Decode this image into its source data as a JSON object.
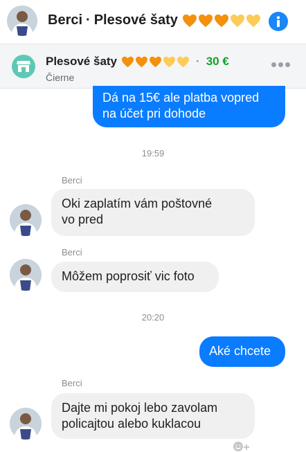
{
  "header": {
    "contact_name": "Berci",
    "separator": "·",
    "item_name": "Plesové šaty",
    "hearts": [
      "orange",
      "orange",
      "orange",
      "yellow",
      "yellow"
    ],
    "info_icon": "info-icon"
  },
  "item_bar": {
    "title": "Plesové šaty",
    "hearts": [
      "orange",
      "orange",
      "orange",
      "yellow",
      "yellow"
    ],
    "separator": "·",
    "price": "30 €",
    "subtitle": "Čierne",
    "shop_icon": "storefront-icon",
    "more_icon": "more-horizontal-icon"
  },
  "messages": [
    {
      "type": "outgoing",
      "text_lines": [
        "Dá na 15€ ale platba vopred",
        "na účet pri dohode"
      ]
    },
    {
      "type": "timestamp",
      "text": "19:59"
    },
    {
      "type": "incoming",
      "sender": "Berci",
      "text_lines": [
        "Oki zaplatím vám  poštovné",
        "vo pred"
      ]
    },
    {
      "type": "incoming",
      "sender": "Berci",
      "text_lines": [
        "Môžem poprosiť vic foto"
      ]
    },
    {
      "type": "timestamp",
      "text": "20:20"
    },
    {
      "type": "outgoing",
      "text_lines": [
        "Aké chcete"
      ]
    },
    {
      "type": "incoming",
      "sender": "Berci",
      "text_lines": [
        "Dajte mi pokoj lebo zavolam",
        "policajtou alebo kuklacou"
      ]
    }
  ],
  "colors": {
    "accent": "#0a7cff",
    "incoming_bubble": "#f0f0f0",
    "price": "#12a12c",
    "heart_orange": "#f4900c",
    "heart_yellow": "#fdcb58",
    "shop_icon_bg": "#5fc8b5"
  }
}
